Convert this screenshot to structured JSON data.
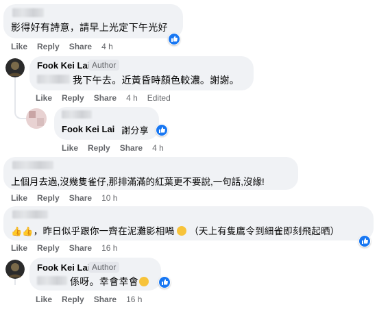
{
  "comments": [
    {
      "id": "c1",
      "text": "影得好有詩意，請早上光定下午光好",
      "actions": [
        "Like",
        "Reply",
        "Share"
      ],
      "time": "4 h",
      "reaction": "like-icon"
    },
    {
      "id": "c2",
      "author": "Fook Kei Lai",
      "author_badge": "Author",
      "text": "我下午去。近黃昏時顏色較濃。謝謝。",
      "actions": [
        "Like",
        "Reply",
        "Share"
      ],
      "time": "4 h",
      "edited": "Edited"
    },
    {
      "id": "c3",
      "author": "Fook Kei Lai",
      "text": "謝分享",
      "actions": [
        "Like",
        "Reply",
        "Share"
      ],
      "time": "4 h",
      "reaction": "like-icon"
    },
    {
      "id": "c4",
      "text": "上個月去過,沒幾隻雀仔,那排滿滿的紅葉更不要說,一句話,沒緣!",
      "actions": [
        "Like",
        "Reply",
        "Share"
      ],
      "time": "10 h"
    },
    {
      "id": "c5",
      "text_prefix": "，昨日似乎跟你一齊在泥灘影相喎",
      "text_suffix": "（天上有隻鷹令到細雀即刻飛起晒）",
      "actions": [
        "Like",
        "Reply",
        "Share"
      ],
      "time": "16 h",
      "reaction": "like-icon"
    },
    {
      "id": "c6",
      "author": "Fook Kei Lai",
      "author_badge": "Author",
      "text": "係呀。幸會幸會",
      "actions": [
        "Like",
        "Reply",
        "Share"
      ],
      "time": "16 h",
      "reaction": "like-icon"
    }
  ],
  "colors": {
    "bubble": "#f0f2f5",
    "secondary_text": "#65676b",
    "like_blue": "#1877f2"
  }
}
